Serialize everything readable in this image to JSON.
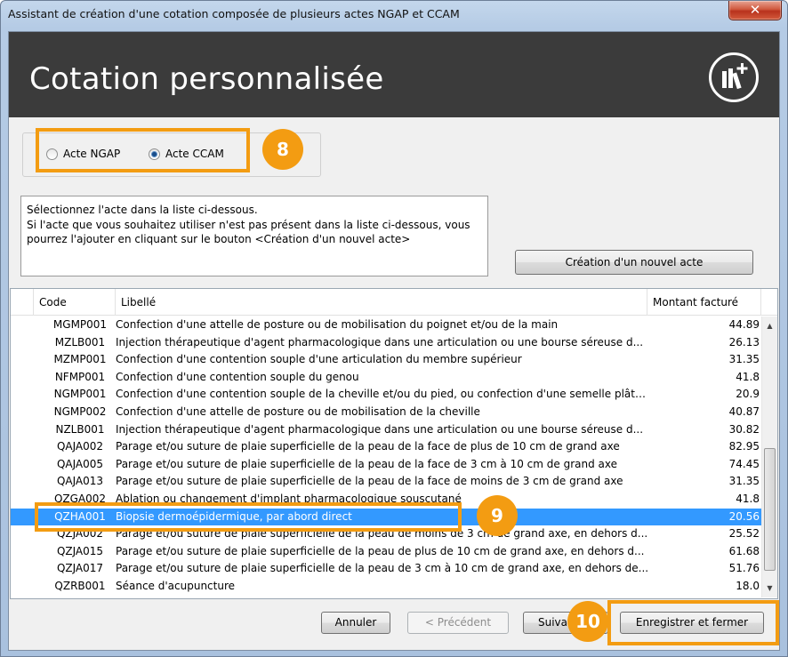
{
  "window": {
    "title": "Assistant de création d'une cotation composée de plusieurs actes NGAP et CCAM",
    "close_glyph": "✕"
  },
  "banner": {
    "title": "Cotation personnalisée",
    "icon": "book-add-icon"
  },
  "radio": {
    "ngap_label": "Acte NGAP",
    "ccam_label": "Acte CCAM",
    "selected": "ccam"
  },
  "info": {
    "line1": "Sélectionnez l'acte dans la liste ci-dessous.",
    "line2": "Si l'acte que vous souhaitez utiliser n'est pas présent dans la liste ci-dessous, vous",
    "line3": "pourrez l'ajouter en cliquant sur le bouton <Création d'un nouvel acte>"
  },
  "create_button": "Création d'un nouvel acte",
  "table": {
    "columns": {
      "code": "Code",
      "libelle": "Libellé",
      "montant": "Montant facturé"
    },
    "rows": [
      {
        "code": "MGMP001",
        "libelle": "Confection d'une attelle de posture ou de mobilisation du poignet et/ou de la main",
        "montant": "44.89"
      },
      {
        "code": "MZLB001",
        "libelle": "Injection thérapeutique d'agent pharmacologique dans une articulation ou une bourse séreuse d...",
        "montant": "26.13"
      },
      {
        "code": "MZMP001",
        "libelle": "Confection d'une contention souple d'une articulation du membre supérieur",
        "montant": "31.35"
      },
      {
        "code": "NFMP001",
        "libelle": "Confection d'une contention souple du genou",
        "montant": "41.8"
      },
      {
        "code": "NGMP001",
        "libelle": "Confection d'une contention souple de la cheville et/ou du pied, ou confection d'une semelle plâtrée",
        "montant": "20.9"
      },
      {
        "code": "NGMP002",
        "libelle": "Confection d'une attelle de posture ou de mobilisation de la cheville",
        "montant": "40.87"
      },
      {
        "code": "NZLB001",
        "libelle": "Injection thérapeutique d'agent pharmacologique dans une articulation ou une bourse séreuse d...",
        "montant": "30.82"
      },
      {
        "code": "QAJA002",
        "libelle": "Parage et/ou suture de plaie superficielle de la peau de la face de plus de 10 cm de grand axe",
        "montant": "82.95"
      },
      {
        "code": "QAJA005",
        "libelle": "Parage et/ou suture de plaie superficielle de la peau de la face de 3 cm à 10 cm de grand axe",
        "montant": "74.45"
      },
      {
        "code": "QAJA013",
        "libelle": "Parage et/ou suture de plaie superficielle de la peau de la face de moins de 3 cm de grand axe",
        "montant": "31.35"
      },
      {
        "code": "QZGA002",
        "libelle": "Ablation ou changement d'implant pharmacologique souscutané",
        "montant": "41.8"
      },
      {
        "code": "QZHA001",
        "libelle": "Biopsie dermoépidermique, par abord direct",
        "montant": "20.56"
      },
      {
        "code": "QZJA002",
        "libelle": "Parage et/ou suture de plaie superficielle de la peau de moins de 3 cm de grand axe, en dehors d...",
        "montant": "25.52"
      },
      {
        "code": "QZJA015",
        "libelle": "Parage et/ou suture de plaie superficielle de la peau de plus de 10 cm de grand axe, en dehors d...",
        "montant": "61.68"
      },
      {
        "code": "QZJA017",
        "libelle": "Parage et/ou suture de plaie superficielle de la peau de 3 cm à 10 cm de grand axe, en dehors de...",
        "montant": "51.76"
      },
      {
        "code": "QZRB001",
        "libelle": "Séance d'acupuncture",
        "montant": "18.0"
      }
    ],
    "selected_index": 11
  },
  "footer": {
    "cancel": "Annuler",
    "previous": "< Précédent",
    "next": "Suivant",
    "save_close": "Enregistrer et fermer"
  },
  "badges": {
    "step8": "8",
    "step9": "9",
    "step10": "10"
  },
  "colors": {
    "accent": "#f39c12",
    "selection": "#3399ff",
    "banner": "#3b3b3b"
  }
}
